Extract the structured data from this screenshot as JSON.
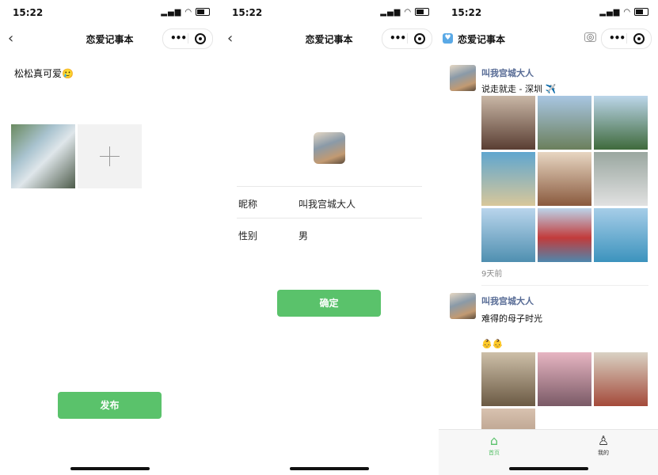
{
  "status": {
    "time": "15:22"
  },
  "panel1": {
    "nav_title": "恋爱记事本",
    "post_text": "松松真可爱🥲",
    "publish_label": "发布"
  },
  "panel2": {
    "nav_title": "恋爱记事本",
    "nickname_label": "昵称",
    "nickname_value": "叫我宫城大人",
    "gender_label": "性别",
    "gender_value": "男",
    "confirm_label": "确定"
  },
  "panel3": {
    "nav_title": "恋爱记事本",
    "posts": [
      {
        "author": "叫我宫城大人",
        "text": "说走就走 - 深圳 ✈️",
        "time": "9天前"
      },
      {
        "author": "叫我宫城大人",
        "text": "难得的母子时光",
        "text2": "👶👶"
      }
    ],
    "tabs": [
      {
        "label": "首页",
        "icon": "home-icon"
      },
      {
        "label": "我的",
        "icon": "user-icon"
      }
    ]
  },
  "colors": {
    "accent": "#5ac26b",
    "name_link": "#576b95"
  }
}
